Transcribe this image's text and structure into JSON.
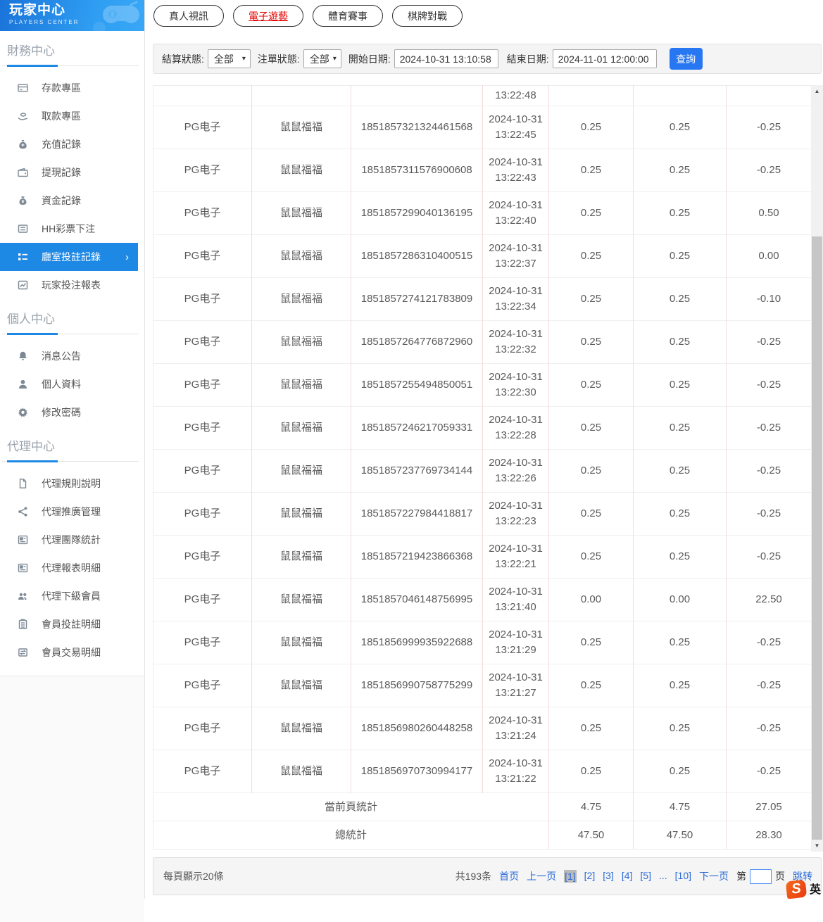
{
  "header": {
    "title": "玩家中心",
    "subtitle": "PLAYERS CENTER"
  },
  "sidebar": {
    "sections": [
      {
        "title": "財務中心",
        "items": [
          {
            "label": "存款專區",
            "icon": "deposit-card-icon"
          },
          {
            "label": "取款專區",
            "icon": "withdraw-hand-icon"
          },
          {
            "label": "充值記錄",
            "icon": "recharge-bag-icon"
          },
          {
            "label": "提現記錄",
            "icon": "withdraw-record-icon"
          },
          {
            "label": "資金記錄",
            "icon": "funds-bag-icon"
          },
          {
            "label": "HH彩票下注",
            "icon": "lottery-list-icon"
          },
          {
            "label": "廳室投註記錄",
            "icon": "bet-record-icon",
            "active": true,
            "arrow": "›"
          },
          {
            "label": "玩家投注報表",
            "icon": "report-chart-icon"
          }
        ]
      },
      {
        "title": "個人中心",
        "items": [
          {
            "label": "消息公告",
            "icon": "bell-icon"
          },
          {
            "label": "個人資料",
            "icon": "person-icon"
          },
          {
            "label": "修改密碼",
            "icon": "gear-icon"
          }
        ]
      },
      {
        "title": "代理中心",
        "items": [
          {
            "label": "代理規則說明",
            "icon": "doc-icon"
          },
          {
            "label": "代理推廣管理",
            "icon": "share-icon"
          },
          {
            "label": "代理團隊統計",
            "icon": "team-stats-icon"
          },
          {
            "label": "代理報表明細",
            "icon": "report-detail-icon"
          },
          {
            "label": "代理下級會員",
            "icon": "users-icon"
          },
          {
            "label": "會員投註明細",
            "icon": "member-bet-icon"
          },
          {
            "label": "會員交易明細",
            "icon": "member-trade-icon"
          }
        ]
      }
    ]
  },
  "tabs": [
    {
      "label": "真人視訊"
    },
    {
      "label": "電子遊藝",
      "active": true
    },
    {
      "label": "體育賽事"
    },
    {
      "label": "棋牌對戰"
    }
  ],
  "filters": {
    "settle_label": "結算狀態:",
    "settle_value": "全部",
    "order_label": "注單狀態:",
    "order_value": "全部",
    "start_label": "開始日期:",
    "start_value": "2024-10-31 13:10:58",
    "end_label": "結束日期:",
    "end_value": "2024-11-01 12:00:00",
    "search_label": "查詢",
    "chevron": "▾"
  },
  "table": {
    "partial_time": "13:22:48",
    "rows": [
      {
        "platform": "PG电子",
        "player": "鼠鼠福福",
        "order": "1851857321324461568",
        "date": "2024-10-31",
        "time": "13:22:45",
        "bet": "0.25",
        "valid": "0.25",
        "result": "-0.25"
      },
      {
        "platform": "PG电子",
        "player": "鼠鼠福福",
        "order": "1851857311576900608",
        "date": "2024-10-31",
        "time": "13:22:43",
        "bet": "0.25",
        "valid": "0.25",
        "result": "-0.25"
      },
      {
        "platform": "PG电子",
        "player": "鼠鼠福福",
        "order": "1851857299040136195",
        "date": "2024-10-31",
        "time": "13:22:40",
        "bet": "0.25",
        "valid": "0.25",
        "result": "0.50"
      },
      {
        "platform": "PG电子",
        "player": "鼠鼠福福",
        "order": "1851857286310400515",
        "date": "2024-10-31",
        "time": "13:22:37",
        "bet": "0.25",
        "valid": "0.25",
        "result": "0.00"
      },
      {
        "platform": "PG电子",
        "player": "鼠鼠福福",
        "order": "1851857274121783809",
        "date": "2024-10-31",
        "time": "13:22:34",
        "bet": "0.25",
        "valid": "0.25",
        "result": "-0.10"
      },
      {
        "platform": "PG电子",
        "player": "鼠鼠福福",
        "order": "1851857264776872960",
        "date": "2024-10-31",
        "time": "13:22:32",
        "bet": "0.25",
        "valid": "0.25",
        "result": "-0.25"
      },
      {
        "platform": "PG电子",
        "player": "鼠鼠福福",
        "order": "1851857255494850051",
        "date": "2024-10-31",
        "time": "13:22:30",
        "bet": "0.25",
        "valid": "0.25",
        "result": "-0.25"
      },
      {
        "platform": "PG电子",
        "player": "鼠鼠福福",
        "order": "1851857246217059331",
        "date": "2024-10-31",
        "time": "13:22:28",
        "bet": "0.25",
        "valid": "0.25",
        "result": "-0.25"
      },
      {
        "platform": "PG电子",
        "player": "鼠鼠福福",
        "order": "1851857237769734144",
        "date": "2024-10-31",
        "time": "13:22:26",
        "bet": "0.25",
        "valid": "0.25",
        "result": "-0.25"
      },
      {
        "platform": "PG电子",
        "player": "鼠鼠福福",
        "order": "1851857227984418817",
        "date": "2024-10-31",
        "time": "13:22:23",
        "bet": "0.25",
        "valid": "0.25",
        "result": "-0.25"
      },
      {
        "platform": "PG电子",
        "player": "鼠鼠福福",
        "order": "1851857219423866368",
        "date": "2024-10-31",
        "time": "13:22:21",
        "bet": "0.25",
        "valid": "0.25",
        "result": "-0.25"
      },
      {
        "platform": "PG电子",
        "player": "鼠鼠福福",
        "order": "1851857046148756995",
        "date": "2024-10-31",
        "time": "13:21:40",
        "bet": "0.00",
        "valid": "0.00",
        "result": "22.50"
      },
      {
        "platform": "PG电子",
        "player": "鼠鼠福福",
        "order": "1851856999935922688",
        "date": "2024-10-31",
        "time": "13:21:29",
        "bet": "0.25",
        "valid": "0.25",
        "result": "-0.25"
      },
      {
        "platform": "PG电子",
        "player": "鼠鼠福福",
        "order": "1851856990758775299",
        "date": "2024-10-31",
        "time": "13:21:27",
        "bet": "0.25",
        "valid": "0.25",
        "result": "-0.25"
      },
      {
        "platform": "PG电子",
        "player": "鼠鼠福福",
        "order": "1851856980260448258",
        "date": "2024-10-31",
        "time": "13:21:24",
        "bet": "0.25",
        "valid": "0.25",
        "result": "-0.25"
      },
      {
        "platform": "PG电子",
        "player": "鼠鼠福福",
        "order": "1851856970730994177",
        "date": "2024-10-31",
        "time": "13:21:22",
        "bet": "0.25",
        "valid": "0.25",
        "result": "-0.25"
      }
    ],
    "summaries": [
      {
        "label": "當前頁統計",
        "bet": "4.75",
        "valid": "4.75",
        "result": "27.05"
      },
      {
        "label": "總統計",
        "bet": "47.50",
        "valid": "47.50",
        "result": "28.30"
      }
    ]
  },
  "pagination": {
    "per_page": "每頁顯示20條",
    "total": "共193条",
    "first": "首页",
    "prev": "上一页",
    "pages": [
      {
        "label": "[1]",
        "active": true
      },
      {
        "label": "[2]"
      },
      {
        "label": "[3]"
      },
      {
        "label": "[4]"
      },
      {
        "label": "[5]"
      },
      {
        "label": "..."
      },
      {
        "label": "[10]"
      }
    ],
    "next": "下一页",
    "jump_prefix": "第",
    "jump_suffix": "页",
    "jump_action": "跳转",
    "jump_value": ""
  },
  "scrollbar": {
    "up": "▲",
    "down": "▼"
  },
  "ime": {
    "logo": "S",
    "mode": "英"
  },
  "colors": {
    "accent_blue": "#1e88e5",
    "active_red": "#e60000",
    "link_blue": "#2b6bd8",
    "border_pink": "#f3dcdc",
    "border_gray": "#efefef",
    "button_blue": "#2877f2"
  }
}
